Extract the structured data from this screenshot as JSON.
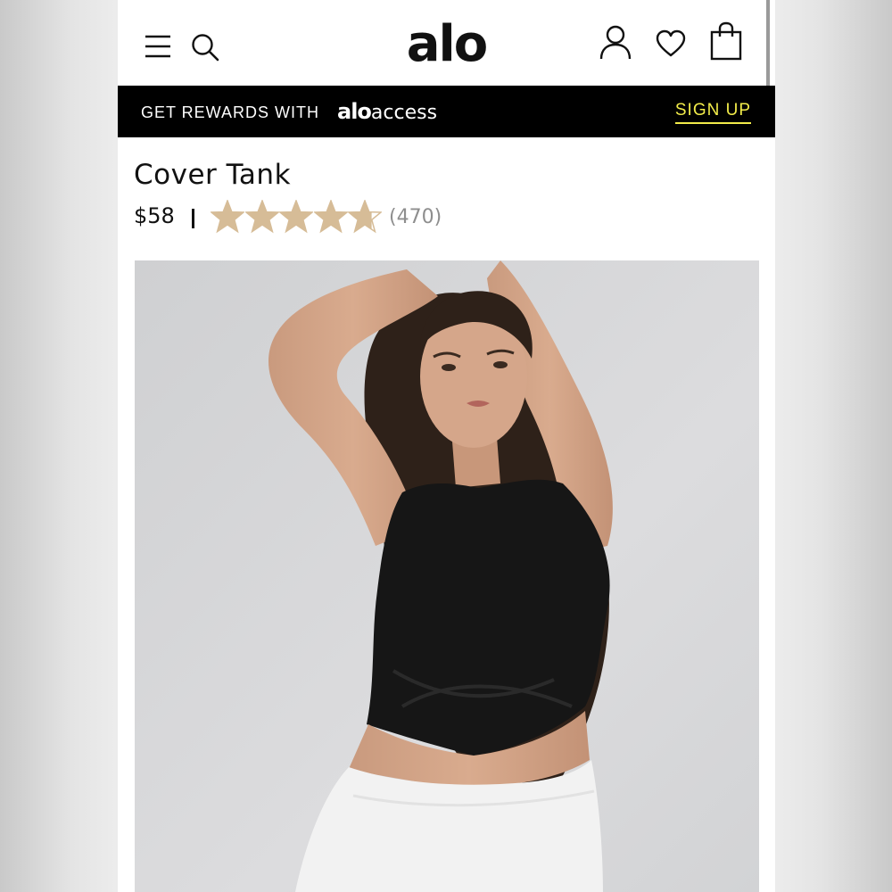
{
  "header": {
    "logo": "alo",
    "icons": [
      "menu-icon",
      "search-icon",
      "account-icon",
      "heart-icon",
      "shopping-bag-icon"
    ]
  },
  "promo": {
    "text": "GET REWARDS WITH",
    "brand_bold": "alo",
    "brand_light": "access",
    "signup_label": "SIGN UP",
    "accent_color": "#f2ec4a"
  },
  "product": {
    "title": "Cover Tank",
    "price": "$58",
    "rating": 4.7,
    "rating_max": 5,
    "review_count": "(470)",
    "star_color": "#d6bc97"
  }
}
